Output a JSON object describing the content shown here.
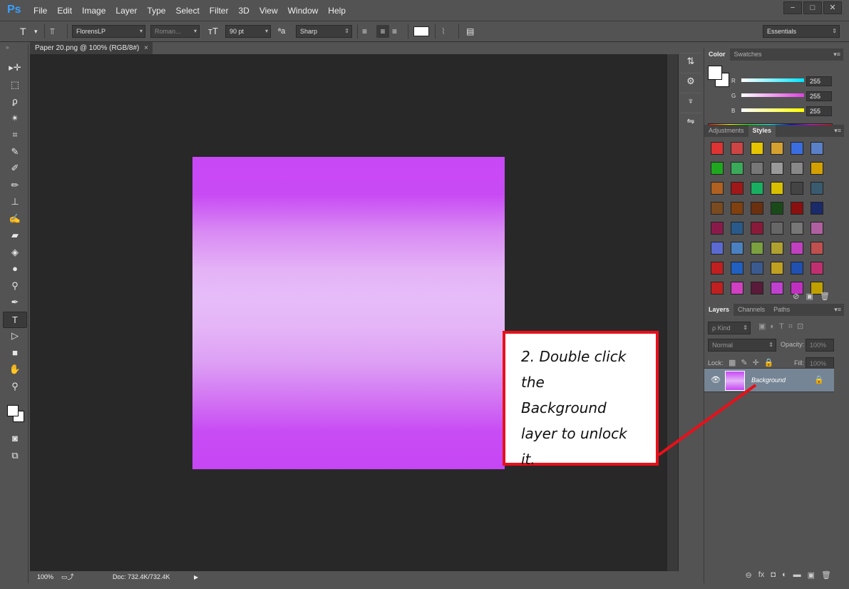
{
  "app": {
    "logo": "Ps"
  },
  "menu": [
    "File",
    "Edit",
    "Image",
    "Layer",
    "Type",
    "Select",
    "Filter",
    "3D",
    "View",
    "Window",
    "Help"
  ],
  "window_controls": [
    "−",
    "□",
    "✕"
  ],
  "options": {
    "tool_glyph": "T",
    "font_family": "FlorensLP",
    "font_style": "Roman...",
    "font_size": "90 pt",
    "aa_label": "ªa",
    "antialias": "Sharp",
    "workspace": "Essentials"
  },
  "document": {
    "tab_title": "Paper 20.png @ 100% (RGB/8#)",
    "tab_close": "×",
    "zoom": "100%",
    "doc_size": "Doc: 732.4K/732.4K"
  },
  "tools": [
    {
      "name": "move-tool",
      "glyph": "▸✛"
    },
    {
      "name": "marquee-tool",
      "glyph": "⬚"
    },
    {
      "name": "lasso-tool",
      "glyph": "ϼ"
    },
    {
      "name": "magic-wand-tool",
      "glyph": "✴"
    },
    {
      "name": "crop-tool",
      "glyph": "⌗"
    },
    {
      "name": "eyedropper-tool",
      "glyph": "✎"
    },
    {
      "name": "healing-brush-tool",
      "glyph": "✐"
    },
    {
      "name": "brush-tool",
      "glyph": "✏"
    },
    {
      "name": "clone-stamp-tool",
      "glyph": "⊥"
    },
    {
      "name": "history-brush-tool",
      "glyph": "✍"
    },
    {
      "name": "eraser-tool",
      "glyph": "▰"
    },
    {
      "name": "paint-bucket-tool",
      "glyph": "◈"
    },
    {
      "name": "blur-tool",
      "glyph": "●"
    },
    {
      "name": "dodge-tool",
      "glyph": "⚲"
    },
    {
      "name": "pen-tool",
      "glyph": "✒"
    },
    {
      "name": "type-tool",
      "glyph": "T"
    },
    {
      "name": "path-selection-tool",
      "glyph": "▷"
    },
    {
      "name": "rectangle-tool",
      "glyph": "■"
    },
    {
      "name": "hand-tool",
      "glyph": "✋"
    },
    {
      "name": "zoom-tool",
      "glyph": "⚲"
    }
  ],
  "color_panel": {
    "tabs": [
      "Color",
      "Swatches"
    ],
    "channels": [
      {
        "label": "R",
        "value": "255",
        "color": "#00e5ff"
      },
      {
        "label": "G",
        "value": "255",
        "color": "#e040e0"
      },
      {
        "label": "B",
        "value": "255",
        "color": "#ffff00"
      }
    ]
  },
  "styles_panel": {
    "tabs": [
      "Adjustments",
      "Styles"
    ],
    "swatches": [
      "#d33",
      "#c44",
      "#e6c400",
      "#d4a030",
      "#3a6ee0",
      "#5a80c8",
      "#1fa81f",
      "#3aaa5a",
      "#777",
      "#999",
      "#888",
      "#d4a000",
      "#b06020",
      "#a01818",
      "#18b060",
      "#d8c000",
      "#444",
      "#3a5a70",
      "#7a4a20",
      "#804010",
      "#6a3010",
      "#1a4a1a",
      "#8a1010",
      "#1a2a6a",
      "#8a1a4a",
      "#2a5a8a",
      "#8a1a3a",
      "#666",
      "#777",
      "#b060a0",
      "#5a6ad0",
      "#4a80c0",
      "#7aa040",
      "#b0a030",
      "#c040c0",
      "#c05050",
      "#c02020",
      "#2060c0",
      "#3a5a90",
      "#c0a020",
      "#2050b0",
      "#c03070",
      "#c02020",
      "#d040c0",
      "#5a1a3a",
      "#c040d0",
      "#c030c0",
      "#c0a000"
    ]
  },
  "layers_panel": {
    "tabs": [
      "Layers",
      "Channels",
      "Paths"
    ],
    "filter": "ρ Kind",
    "blend_mode": "Normal",
    "opacity_label": "Opacity:",
    "opacity_value": "100%",
    "lock_label": "Lock:",
    "fill_label": "Fill:",
    "fill_value": "100%",
    "layer_name": "Background"
  },
  "annotation": {
    "lines": [
      "2.  Double click",
      "the",
      "Background",
      "layer to unlock",
      "it."
    ],
    "border_color": "#e8101a"
  }
}
